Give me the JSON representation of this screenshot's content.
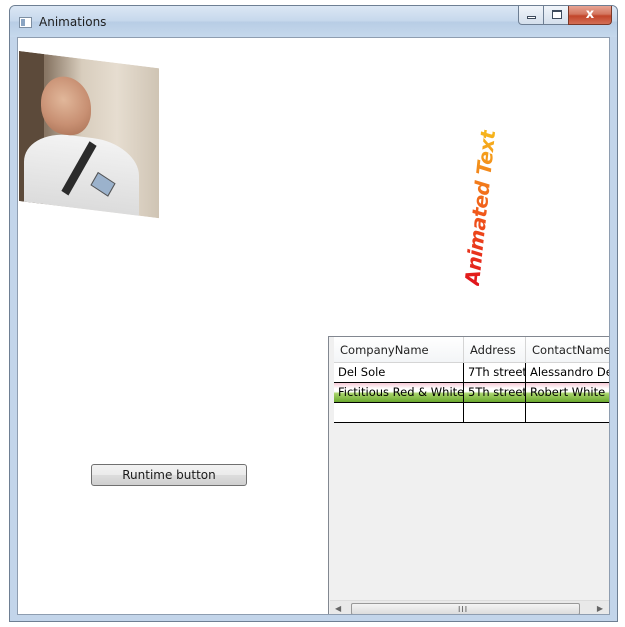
{
  "window": {
    "title": "Animations"
  },
  "caption_buttons": {
    "close_glyph": "x"
  },
  "animated_text": "Animated Text",
  "runtime_button": {
    "label": "Runtime button"
  },
  "grid": {
    "columns": [
      "CompanyName",
      "Address",
      "ContactName"
    ],
    "rows": [
      [
        "Del Sole",
        "7Th street",
        "Alessandro Del S"
      ],
      [
        "Fictitious Red & White",
        "5Th street",
        "Robert White"
      ]
    ]
  },
  "scrollbar": {
    "grip": "III"
  },
  "colors": {
    "text_gradient_start": "#e0141c",
    "text_gradient_end": "#f6b81c",
    "accent_row_top": "#f6c9d6",
    "accent_row_bottom": "#6aa82e"
  }
}
